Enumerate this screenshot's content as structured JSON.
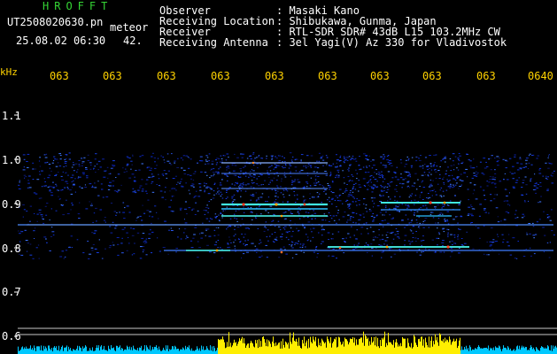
{
  "header": {
    "logo": "HROFFT",
    "filename": "UT2508020630.pn",
    "detect_label": "meteor",
    "datetime": "25.08.02 06:30",
    "count": "42.",
    "info_labels": [
      "Observer",
      "Receiving Location",
      "Receiver",
      "Receiving Antenna"
    ],
    "info_values": [
      ": Masaki Kano",
      ": Shibukawa, Gunma, Japan",
      ": RTL-SDR SDR# 43dB L15 103.2MHz CW",
      ": 3el Yagi(V) Az 330 for Vladivostok"
    ]
  },
  "axis": {
    "unit_label": "kHz",
    "y_ticks": [
      "1.1",
      "1.0",
      "0.9",
      "0.8",
      "0.7",
      "0.6"
    ],
    "time_ticks": [
      "063",
      "063",
      "063",
      "063",
      "063",
      "063",
      "063",
      "063",
      "063",
      "0640"
    ]
  },
  "colors": {
    "background": "#000000",
    "header_green": "#36d436",
    "tick_yellow": "#ffd200",
    "baseline_cyan": "#00c8ff",
    "burst_yellow": "#ffee00"
  }
}
